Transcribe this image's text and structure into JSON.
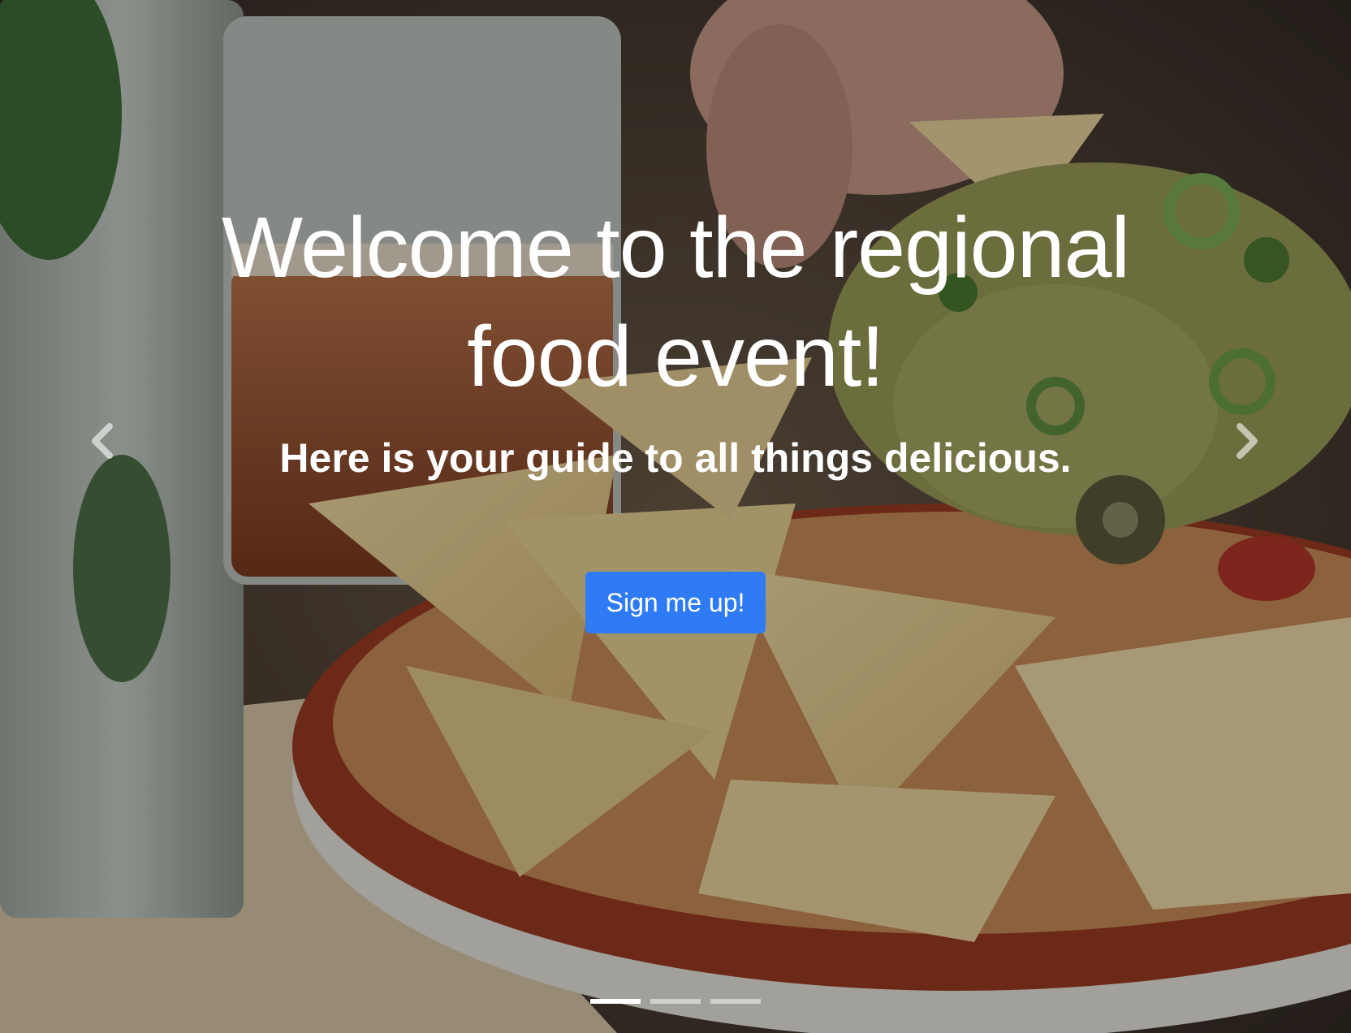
{
  "hero": {
    "title": "Welcome to the regional food event!",
    "subtitle": "Here is your guide to all things delicious.",
    "cta_label": "Sign me up!"
  },
  "colors": {
    "accent": "#2f7bf5",
    "text": "#ffffff"
  },
  "carousel": {
    "prev_icon": "chevron-left-icon",
    "next_icon": "chevron-right-icon",
    "slide_count": 3,
    "active_index": 0
  }
}
